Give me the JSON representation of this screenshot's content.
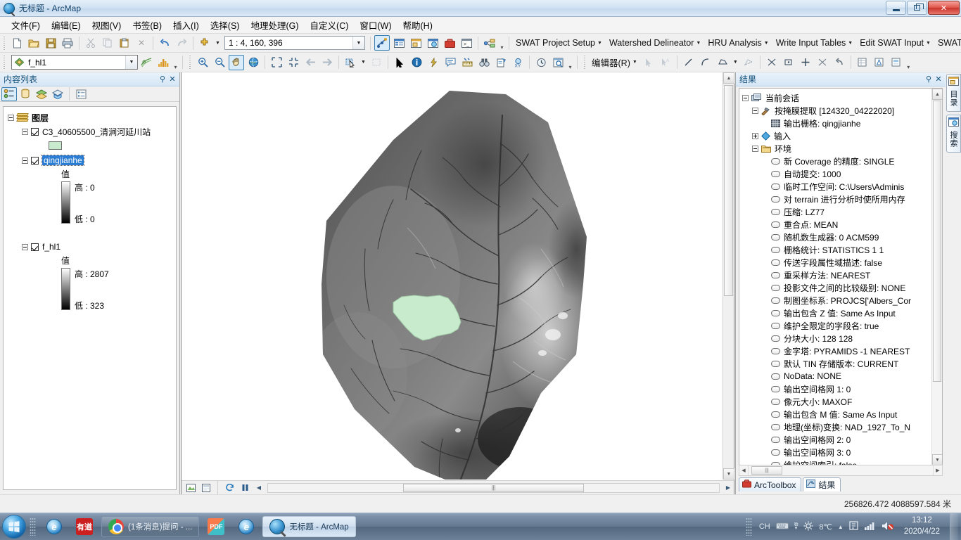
{
  "window": {
    "title": "无标题 - ArcMap",
    "app_icon": "arcmap-globe-icon",
    "minimize_label": "最小化",
    "maximize_label": "最大化",
    "close_label": "关闭"
  },
  "menu": {
    "items": [
      {
        "label": "文件(F)",
        "name": "menu-file"
      },
      {
        "label": "编辑(E)",
        "name": "menu-edit"
      },
      {
        "label": "视图(V)",
        "name": "menu-view"
      },
      {
        "label": "书签(B)",
        "name": "menu-bookmarks"
      },
      {
        "label": "插入(I)",
        "name": "menu-insert"
      },
      {
        "label": "选择(S)",
        "name": "menu-selection"
      },
      {
        "label": "地理处理(G)",
        "name": "menu-geoprocessing"
      },
      {
        "label": "自定义(C)",
        "name": "menu-customize"
      },
      {
        "label": "窗口(W)",
        "name": "menu-window"
      },
      {
        "label": "帮助(H)",
        "name": "menu-help"
      }
    ]
  },
  "toolbar": {
    "scale": "1 : 4, 160, 396",
    "scale_dropdown_caret": "▼",
    "layer_combo_value": "f_hl1",
    "editor_label": "编辑器(R)",
    "swat_menus": [
      "SWAT Project Setup",
      "Watershed Delineator",
      "HRU Analysis",
      "Write Input Tables",
      "Edit SWAT Input",
      "SWAT Simulation"
    ]
  },
  "toc": {
    "title": "内容列表",
    "pin_glyph": "⚲",
    "close_glyph": "✕",
    "toolbar_buttons": [
      "list-by-drawing-order-icon",
      "list-by-source-icon",
      "list-by-visibility-icon",
      "list-by-selection-icon",
      "options-icon"
    ],
    "root": "图层",
    "layers": [
      {
        "name": "C3_40605500_清涧河延川站",
        "checked": true,
        "selected": false,
        "symbol": "polygon-swatch",
        "swatch_color": "#c9ebcd"
      },
      {
        "name": "qingjianhe",
        "checked": true,
        "selected": true,
        "value_label": "值",
        "high_label": "高 : 0",
        "low_label": "低 : 0"
      },
      {
        "name": "f_hl1",
        "checked": true,
        "selected": false,
        "value_label": "值",
        "high_label": "高 : 2807",
        "low_label": "低 : 323"
      }
    ]
  },
  "results": {
    "title": "结果",
    "pin_glyph": "⚲",
    "close_glyph": "✕",
    "tree": [
      {
        "level": 0,
        "icon": "session-icon",
        "label": "当前会话",
        "expander": "minus"
      },
      {
        "level": 1,
        "icon": "tool-hammer-icon",
        "label": "按掩膜提取 [124320_04222020]",
        "expander": "minus"
      },
      {
        "level": 2,
        "icon": "raster-icon",
        "label": "输出栅格: qingjianhe",
        "expander": "none"
      },
      {
        "level": 1,
        "icon": "input-diamond-icon",
        "label": "输入",
        "expander": "plus"
      },
      {
        "level": 1,
        "icon": "environment-icon",
        "label": "环境",
        "expander": "minus"
      },
      {
        "level": 2,
        "icon": "param-icon",
        "label": "新 Coverage 的精度: SINGLE",
        "expander": "none"
      },
      {
        "level": 2,
        "icon": "param-icon",
        "label": "自动提交: 1000",
        "expander": "none"
      },
      {
        "level": 2,
        "icon": "param-icon",
        "label": "临时工作空间: C:\\Users\\Adminis",
        "expander": "none"
      },
      {
        "level": 2,
        "icon": "param-icon",
        "label": "对 terrain 进行分析时使所用内存",
        "expander": "none"
      },
      {
        "level": 2,
        "icon": "param-icon",
        "label": "压缩: LZ77",
        "expander": "none"
      },
      {
        "level": 2,
        "icon": "param-icon",
        "label": "重合点: MEAN",
        "expander": "none"
      },
      {
        "level": 2,
        "icon": "param-icon",
        "label": "随机数生成器: 0 ACM599",
        "expander": "none"
      },
      {
        "level": 2,
        "icon": "param-icon",
        "label": "栅格统计: STATISTICS 1 1",
        "expander": "none"
      },
      {
        "level": 2,
        "icon": "param-icon",
        "label": "传送字段属性域描述: false",
        "expander": "none"
      },
      {
        "level": 2,
        "icon": "param-icon",
        "label": "重采样方法: NEAREST",
        "expander": "none"
      },
      {
        "level": 2,
        "icon": "param-icon",
        "label": "投影文件之间的比较级别: NONE",
        "expander": "none"
      },
      {
        "level": 2,
        "icon": "param-icon",
        "label": "制图坐标系: PROJCS['Albers_Cor",
        "expander": "none"
      },
      {
        "level": 2,
        "icon": "param-icon",
        "label": "输出包含 Z 值: Same As Input",
        "expander": "none"
      },
      {
        "level": 2,
        "icon": "param-icon",
        "label": "维护全限定的字段名: true",
        "expander": "none"
      },
      {
        "level": 2,
        "icon": "param-icon",
        "label": "分块大小: 128 128",
        "expander": "none"
      },
      {
        "level": 2,
        "icon": "param-icon",
        "label": "金字塔: PYRAMIDS -1 NEAREST",
        "expander": "none"
      },
      {
        "level": 2,
        "icon": "param-icon",
        "label": "默认 TIN 存储版本: CURRENT",
        "expander": "none"
      },
      {
        "level": 2,
        "icon": "param-icon",
        "label": "NoData: NONE",
        "expander": "none"
      },
      {
        "level": 2,
        "icon": "param-icon",
        "label": "输出空间格网 1: 0",
        "expander": "none"
      },
      {
        "level": 2,
        "icon": "param-icon",
        "label": "像元大小: MAXOF",
        "expander": "none"
      },
      {
        "level": 2,
        "icon": "param-icon",
        "label": "输出包含 M 值: Same As Input",
        "expander": "none"
      },
      {
        "level": 2,
        "icon": "param-icon",
        "label": "地理(坐标)变换: NAD_1927_To_N",
        "expander": "none"
      },
      {
        "level": 2,
        "icon": "param-icon",
        "label": "输出空间格网 2: 0",
        "expander": "none"
      },
      {
        "level": 2,
        "icon": "param-icon",
        "label": "输出空间格网 3: 0",
        "expander": "none"
      },
      {
        "level": 2,
        "icon": "param-icon",
        "label": "维护空间索引: false",
        "expander": "none"
      }
    ],
    "tabs": [
      {
        "label": "ArcToolbox",
        "icon": "arctoolbox-icon",
        "active": false
      },
      {
        "label": "结果",
        "icon": "results-icon",
        "active": true
      }
    ],
    "side_tabs": [
      {
        "label": "目录",
        "icon": "catalog-icon"
      },
      {
        "label": "搜索",
        "icon": "search-icon"
      }
    ]
  },
  "status": {
    "coordinates": "256826.472  4088597.584 米"
  },
  "taskbar": {
    "start_label": "开始",
    "items": [
      {
        "label": "",
        "icon": "ie-icon",
        "iconic": true,
        "active": false
      },
      {
        "label": "",
        "icon": "youdao-icon",
        "icon_text": "有道",
        "iconic": true,
        "active": false
      },
      {
        "label": "(1条消息)提问 - ...",
        "icon": "chrome-icon",
        "iconic": false,
        "active": false
      },
      {
        "label": "",
        "icon": "pdf-icon",
        "icon_text": "PDF",
        "iconic": true,
        "active": false
      },
      {
        "label": "",
        "icon": "ie-icon",
        "iconic": true,
        "active": false
      },
      {
        "label": "无标题 - ArcMap",
        "icon": "arcmap-icon",
        "iconic": false,
        "active": true
      }
    ],
    "tray": {
      "ime": "CH",
      "temperature": "8℃",
      "time": "13:12",
      "date": "2020/4/22"
    }
  },
  "map": {
    "layer_name": "qingjianhe",
    "basin_fill": "#c9ebcd",
    "hscroll_grip": "|||"
  }
}
